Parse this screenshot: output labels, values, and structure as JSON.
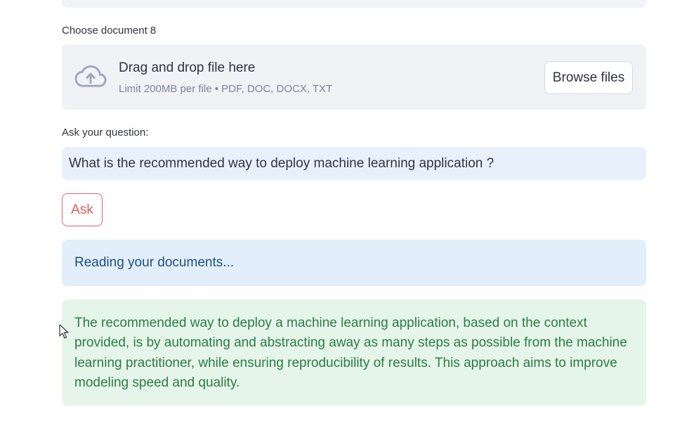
{
  "document_label": "Choose document 8",
  "uploader": {
    "icon": "cloud-upload-icon",
    "title": "Drag and drop file here",
    "limit_text": "Limit 200MB per file • PDF, DOC, DOCX, TXT",
    "browse_label": "Browse files"
  },
  "question": {
    "label": "Ask your question:",
    "value": "What is the recommended way to deploy machine learning application ?"
  },
  "ask_button": {
    "label": "Ask"
  },
  "info": {
    "text": "Reading your documents..."
  },
  "answer": {
    "text": "The recommended way to deploy a machine learning application, based on the context provided, is by automating and abstracting away as many steps as possible from the machine learning practitioner, while ensuring reproducibility of results. This approach aims to improve modeling speed and quality."
  },
  "colors": {
    "accent": "#e05a5a",
    "info_bg": "#e3eefb",
    "success_bg": "#e5f5e9"
  }
}
